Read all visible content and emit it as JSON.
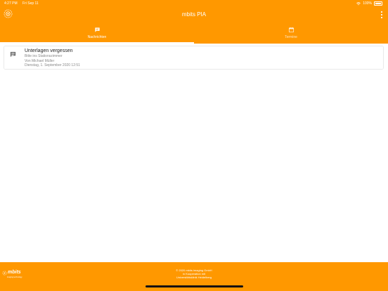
{
  "status_bar": {
    "time": "4:27 PM",
    "date": "Fri Sep 11",
    "battery": "100%"
  },
  "header": {
    "title": "mbits PIA"
  },
  "tabs": [
    {
      "label": "Nachrichten",
      "icon": "chat-icon",
      "selected": true
    },
    {
      "label": "Termine",
      "icon": "calendar-icon",
      "selected": false
    }
  ],
  "messages": [
    {
      "icon": "message-icon",
      "title": "Unterlagen vergessen",
      "subtitle": "Bitte ins Stationszimmer",
      "sender": "Von Michael Müller",
      "timestamp": "Dienstag, 1. September 2020 12:51"
    }
  ],
  "footer": {
    "brand": "mbits",
    "tagline": "imaging technology",
    "copyright_lines": [
      "© 2020 mbits imaging GmbH",
      "in Kooperation mit",
      "Universitätsklinik Heidelberg"
    ]
  },
  "colors": {
    "primary": "#ff9800",
    "on_primary": "#ffffff",
    "card_background": "#ffffff"
  }
}
